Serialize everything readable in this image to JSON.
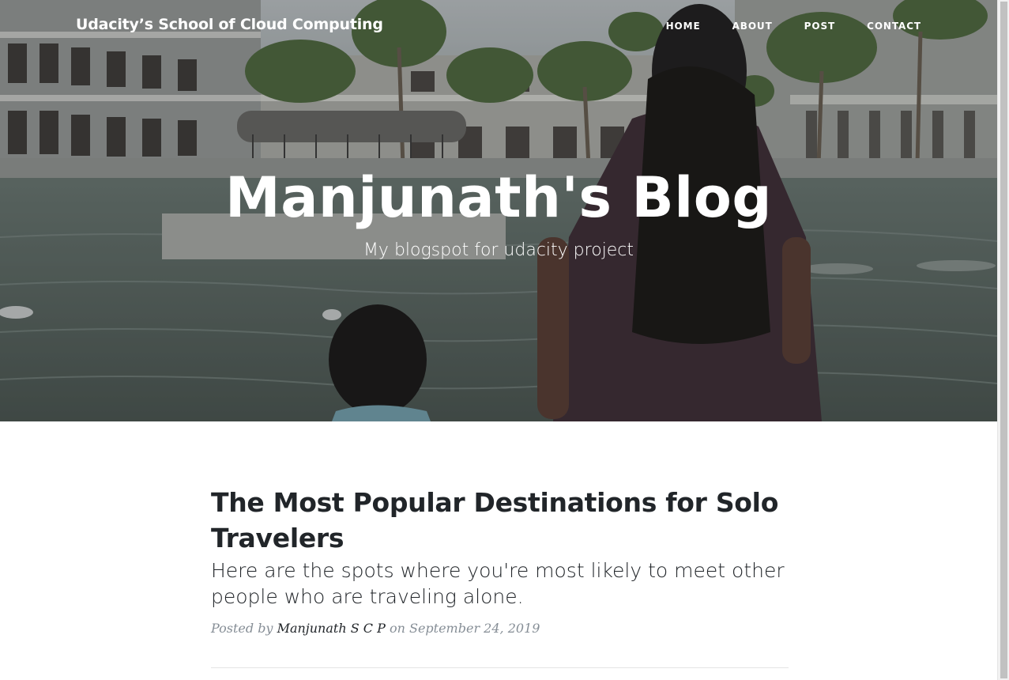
{
  "navbar": {
    "brand": "Udacity’s School of Cloud Computing",
    "links": [
      {
        "label": "HOME"
      },
      {
        "label": "ABOUT"
      },
      {
        "label": "POST"
      },
      {
        "label": "CONTACT"
      }
    ]
  },
  "hero": {
    "title": "Manjunath's Blog",
    "subtitle": "My blogspot for udacity project"
  },
  "post": {
    "title": "The Most Popular Destinations for Solo Travelers",
    "subtitle": "Here are the spots where you're most likely to meet other people who are traveling alone.",
    "meta_prefix": "Posted by",
    "author": "Manjunath S C P",
    "meta_date_prefix": "on",
    "date": "September 24, 2019"
  },
  "colors": {
    "text": "#212529",
    "meta": "#868e96",
    "divider": "#e5e5e5"
  }
}
